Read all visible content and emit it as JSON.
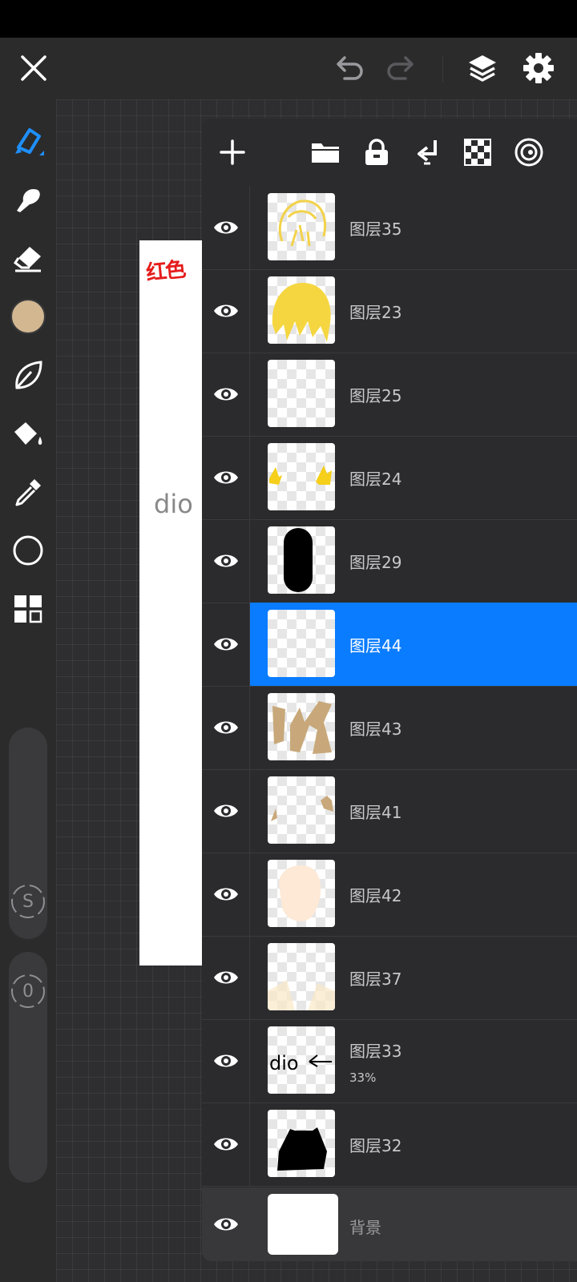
{
  "topbar": {
    "close_icon": "close-icon",
    "undo_icon": "undo-icon",
    "redo_icon": "redo-icon",
    "layers_icon": "layers-icon",
    "settings_icon": "gear-icon"
  },
  "tools": [
    "brush",
    "smudge",
    "eraser",
    "color",
    "leaf",
    "fill",
    "eyedropper",
    "shape",
    "grid"
  ],
  "colors": {
    "current_color": "#d2b791",
    "accent": "#0a7cff",
    "panel": "#2b2b2d"
  },
  "sliders": {
    "size_label": "S",
    "opacity_label": "0"
  },
  "canvas": {
    "dio_text": "dio"
  },
  "layers_panel": {
    "header_icons": [
      "add-icon",
      "folder-icon",
      "lock-icon",
      "merge-down-icon",
      "checkerboard-icon",
      "target-icon"
    ],
    "layers": [
      {
        "name": "图层35",
        "opacity": "",
        "selected": false,
        "thumb": "yellow-sketch"
      },
      {
        "name": "图层23",
        "opacity": "",
        "selected": false,
        "thumb": "yellow-hair"
      },
      {
        "name": "图层25",
        "opacity": "",
        "selected": false,
        "thumb": "empty"
      },
      {
        "name": "图层24",
        "opacity": "",
        "selected": false,
        "thumb": "yellow-tufts"
      },
      {
        "name": "图层29",
        "opacity": "",
        "selected": false,
        "thumb": "black-capsule"
      },
      {
        "name": "图层44",
        "opacity": "",
        "selected": true,
        "thumb": "empty"
      },
      {
        "name": "图层43",
        "opacity": "",
        "selected": false,
        "thumb": "tan-shapes"
      },
      {
        "name": "图层41",
        "opacity": "",
        "selected": false,
        "thumb": "tan-bits"
      },
      {
        "name": "图层42",
        "opacity": "",
        "selected": false,
        "thumb": "peach-face"
      },
      {
        "name": "图层37",
        "opacity": "",
        "selected": false,
        "thumb": "faint"
      },
      {
        "name": "图层33",
        "opacity": "33%",
        "selected": false,
        "thumb": "dio-text"
      },
      {
        "name": "图层32",
        "opacity": "",
        "selected": false,
        "thumb": "black-body"
      }
    ],
    "background": {
      "name": "背景"
    }
  }
}
